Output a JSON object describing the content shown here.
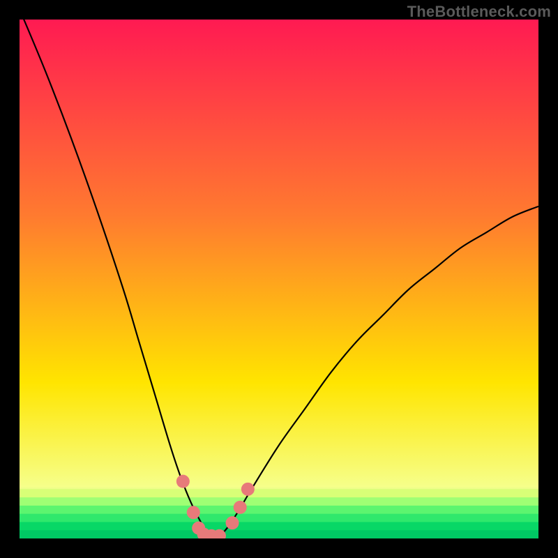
{
  "watermark": "TheBottleneck.com",
  "chart_data": {
    "type": "line",
    "title": "",
    "xlabel": "",
    "ylabel": "",
    "xlim": [
      0,
      100
    ],
    "ylim": [
      0,
      100
    ],
    "x_optimum": 37,
    "series": [
      {
        "name": "bottleneck-curve",
        "x": [
          0,
          5,
          10,
          15,
          20,
          23,
          26,
          29,
          31,
          33,
          35,
          36,
          37,
          38,
          40,
          42,
          45,
          50,
          55,
          60,
          65,
          70,
          75,
          80,
          85,
          90,
          95,
          100
        ],
        "y": [
          102,
          90,
          77,
          63,
          48,
          38,
          28,
          18,
          12,
          7,
          3,
          1,
          0,
          0,
          2,
          5,
          10,
          18,
          25,
          32,
          38,
          43,
          48,
          52,
          56,
          59,
          62,
          64
        ]
      }
    ],
    "markers": {
      "name": "sample-points",
      "color": "#e77a7a",
      "points": [
        {
          "x": 31.5,
          "y": 11
        },
        {
          "x": 33.5,
          "y": 5
        },
        {
          "x": 34.5,
          "y": 2
        },
        {
          "x": 35.5,
          "y": 0.8
        },
        {
          "x": 37.0,
          "y": 0.5
        },
        {
          "x": 38.5,
          "y": 0.5
        },
        {
          "x": 41.0,
          "y": 3
        },
        {
          "x": 42.5,
          "y": 6
        },
        {
          "x": 44.0,
          "y": 9.5
        }
      ]
    },
    "background_gradient": {
      "top": "#ff1a52",
      "mid1": "#ff7b2f",
      "mid2": "#ffe500",
      "band": "#f6ff8a",
      "bottom": "#00e56a"
    },
    "grid": false,
    "legend": false
  }
}
